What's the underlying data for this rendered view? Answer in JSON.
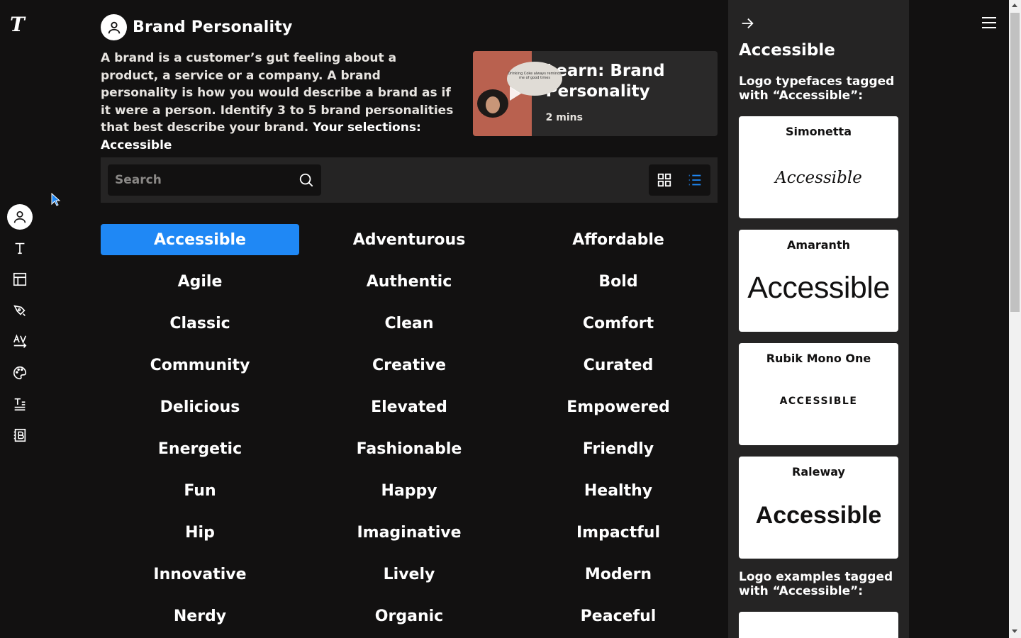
{
  "app": {
    "logo": "T"
  },
  "header": {
    "title": "Brand Personality"
  },
  "intro": {
    "text": "A brand is a customer’s gut feeling about a product, a service or a company. A brand personality is how you would describe a brand as if it were a person. Identify 3 to 5 brand personalities that best describe your brand. ",
    "selections_label": "Your selections: Accessible"
  },
  "learn": {
    "title": "Learn: Brand Personality",
    "duration": "2 mins",
    "thumbnail_caption": "Drinking Coke always reminds me of good times"
  },
  "search": {
    "placeholder": "Search",
    "value": ""
  },
  "tags": [
    {
      "label": "Accessible",
      "selected": true
    },
    {
      "label": "Adventurous"
    },
    {
      "label": "Affordable"
    },
    {
      "label": "Agile"
    },
    {
      "label": "Authentic"
    },
    {
      "label": "Bold"
    },
    {
      "label": "Classic"
    },
    {
      "label": "Clean"
    },
    {
      "label": "Comfort"
    },
    {
      "label": "Community"
    },
    {
      "label": "Creative"
    },
    {
      "label": "Curated"
    },
    {
      "label": "Delicious"
    },
    {
      "label": "Elevated"
    },
    {
      "label": "Empowered"
    },
    {
      "label": "Energetic"
    },
    {
      "label": "Fashionable"
    },
    {
      "label": "Friendly"
    },
    {
      "label": "Fun"
    },
    {
      "label": "Happy"
    },
    {
      "label": "Healthy"
    },
    {
      "label": "Hip"
    },
    {
      "label": "Imaginative"
    },
    {
      "label": "Impactful"
    },
    {
      "label": "Innovative"
    },
    {
      "label": "Lively"
    },
    {
      "label": "Modern"
    },
    {
      "label": "Nerdy"
    },
    {
      "label": "Organic"
    },
    {
      "label": "Peaceful"
    }
  ],
  "panel": {
    "title": "Accessible",
    "typefaces_heading": "Logo typefaces tagged with “Accessible”:",
    "typefaces": [
      {
        "name": "Simonetta",
        "sample": "Accessible"
      },
      {
        "name": "Amaranth",
        "sample": "Accessible"
      },
      {
        "name": "Rubik Mono One",
        "sample": "ACCESSIBLE"
      },
      {
        "name": "Raleway",
        "sample": "Accessible"
      }
    ],
    "examples_heading": "Logo examples tagged with “Accessible”:"
  },
  "colors": {
    "accent": "#1f88f5",
    "background": "#121111",
    "panel": "#252424"
  }
}
